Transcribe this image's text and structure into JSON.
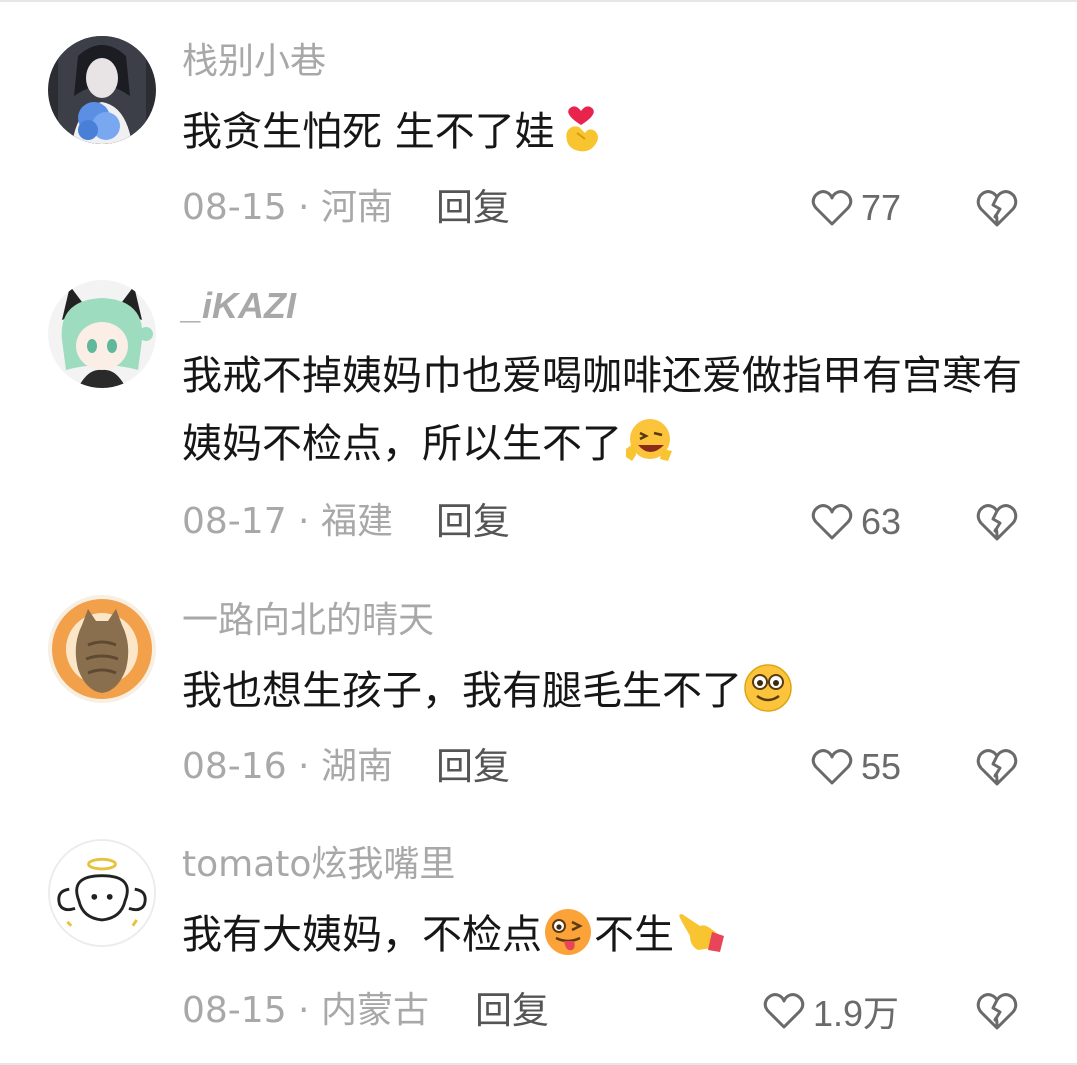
{
  "comments": [
    {
      "username": "栈别小巷",
      "text_parts": [
        "我贪生怕死 生不了娃"
      ],
      "emojis": [
        "finger-heart-emoji"
      ],
      "date": "08-15",
      "location": "河南",
      "reply_label": "回复",
      "likes": "77"
    },
    {
      "username": "_iKAZI",
      "text_parts": [
        "我戒不掉姨妈巾也爱喝咖啡还爱做指甲有宫寒有姨妈不检点，所以生不了"
      ],
      "emojis": [
        "wink-grin-emoji"
      ],
      "date": "08-17",
      "location": "福建",
      "reply_label": "回复",
      "likes": "63"
    },
    {
      "username": "一路向北的晴天",
      "text_parts": [
        "我也想生孩子，我有腿毛生不了"
      ],
      "emojis": [
        "smile-emoji"
      ],
      "date": "08-16",
      "location": "湖南",
      "reply_label": "回复",
      "likes": "55"
    },
    {
      "username": "tomato炫我嘴里",
      "text_parts": [
        "我有大姨妈，不检点",
        "不生"
      ],
      "emojis": [
        "tongue-wink-emoji",
        "pointing-hand-emoji"
      ],
      "date": "08-15",
      "location": "内蒙古",
      "reply_label": "回复",
      "likes": "1.9万"
    }
  ],
  "meta_separator": " · ",
  "colors": {
    "username": "#a8a8a8",
    "text": "#161616",
    "meta": "#a8a8a8",
    "reply": "#555555",
    "icon": "#6a6a6a"
  },
  "icons": [
    "heart-outline-icon",
    "broken-heart-icon"
  ]
}
